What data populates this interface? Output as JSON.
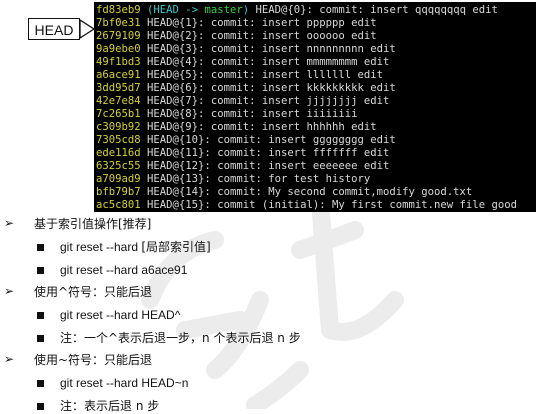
{
  "head_label": "HEAD",
  "terminal": {
    "lines": [
      {
        "hash": "fd83eb9",
        "ref_open": " (",
        "ref_head": "HEAD -> ",
        "ref_branch": "master",
        "ref_close": ")",
        "text": " HEAD@{0}: commit: insert qqqqqqqq edit"
      },
      {
        "hash": "7bf0e31",
        "text": " HEAD@{1}: commit: insert pppppp edit"
      },
      {
        "hash": "2679109",
        "text": " HEAD@{2}: commit: insert oooooo edit"
      },
      {
        "hash": "9a9ebe0",
        "text": " HEAD@{3}: commit: insert nnnnnnnnn edit"
      },
      {
        "hash": "49f1bd3",
        "text": " HEAD@{4}: commit: insert mmmmmmmm edit"
      },
      {
        "hash": "a6ace91",
        "text": " HEAD@{5}: commit: insert lllllll edit"
      },
      {
        "hash": "3dd95d7",
        "text": " HEAD@{6}: commit: insert kkkkkkkkk edit"
      },
      {
        "hash": "42e7e84",
        "text": " HEAD@{7}: commit: insert jjjjjjjj edit"
      },
      {
        "hash": "7c265b1",
        "text": " HEAD@{8}: commit: insert iiiiiiii"
      },
      {
        "hash": "c309b92",
        "text": " HEAD@{9}: commit: insert hhhhhh edit"
      },
      {
        "hash": "7305cd8",
        "text": " HEAD@{10}: commit: insert gggggggg edit"
      },
      {
        "hash": "ede116d",
        "text": " HEAD@{11}: commit: insert fffffff edit"
      },
      {
        "hash": "6325c55",
        "text": " HEAD@{12}: commit: insert eeeeeee edit"
      },
      {
        "hash": "a709ad9",
        "text": " HEAD@{13}: commit: for test history"
      },
      {
        "hash": "bfb79b7",
        "text": " HEAD@{14}: commit: My second commit,modify good.txt"
      },
      {
        "hash": "ac5c801",
        "text": " HEAD@{15}: commit (initial): My first commit.new file good"
      }
    ]
  },
  "doc": {
    "bullet_arrow": "➢",
    "sections": [
      {
        "title": "基于索引值操作[推荐]",
        "items": [
          {
            "en": "git reset --hard ",
            "zh": "[局部索引值]"
          },
          {
            "en": "git reset --hard a6ace91",
            "zh": ""
          }
        ]
      },
      {
        "title": "使用^符号：只能后退",
        "items": [
          {
            "en": "git reset --hard HEAD^",
            "zh": ""
          },
          {
            "en": "",
            "zh": "注：一个^表示后退一步，n 个表示后退 n 步"
          }
        ]
      },
      {
        "title": "使用~符号：只能后退",
        "items": [
          {
            "en": "git reset --hard HEAD~n",
            "zh": ""
          },
          {
            "en": "",
            "zh": "注：表示后退 n 步"
          }
        ]
      }
    ]
  }
}
